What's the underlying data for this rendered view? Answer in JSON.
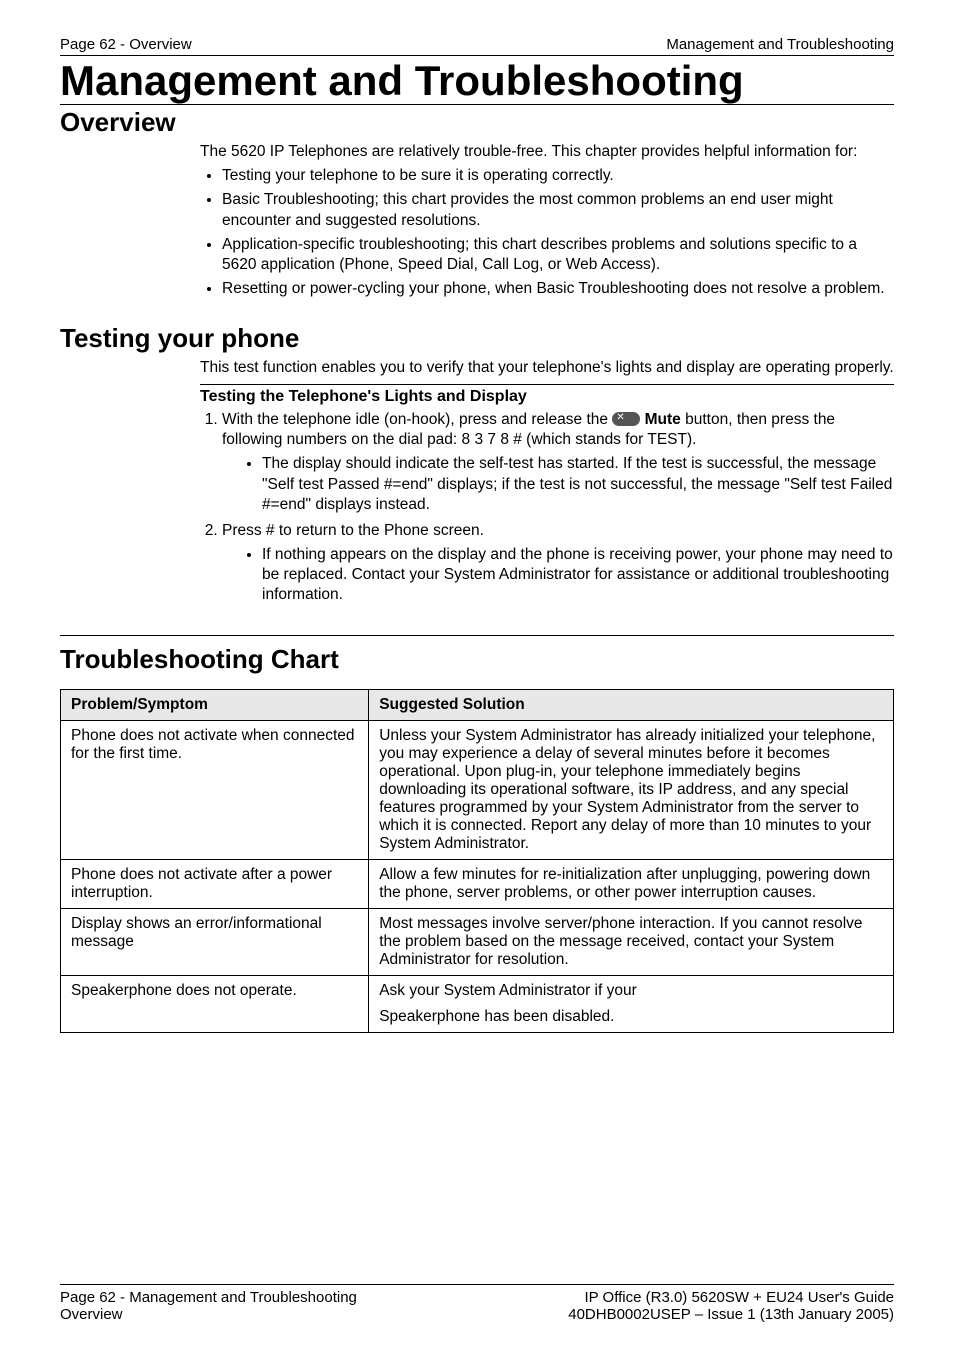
{
  "header": {
    "left": "Page 62 - Overview",
    "right": "Management and Troubleshooting"
  },
  "title": "Management and Troubleshooting",
  "overview": {
    "heading": "Overview",
    "intro": "The 5620 IP Telephones are relatively trouble-free. This chapter provides helpful information for:",
    "bullets": [
      "Testing your telephone to be sure it is operating correctly.",
      "Basic Troubleshooting; this chart provides the most common problems an end user might encounter and suggested resolutions.",
      "Application-specific troubleshooting; this chart describes problems and solutions specific to a 5620 application (Phone, Speed Dial, Call Log, or Web Access).",
      "Resetting or power-cycling your phone, when Basic Troubleshooting does not resolve a problem."
    ]
  },
  "testing": {
    "heading": "Testing your phone",
    "intro": "This test function enables you to verify that your telephone's lights and display are operating properly.",
    "subheading": "Testing the Telephone's Lights and Display",
    "step1_pre": "With the telephone idle (on-hook), press and release the ",
    "mute_label": "Mute",
    "step1_post": " button, then press the following numbers on the dial pad: 8 3 7 8 # (which stands for TEST).",
    "step1_sub": "The display should indicate the self-test has started. If the test is successful, the message \"Self test Passed #=end\" displays; if the test is not successful, the message \"Self test Failed #=end\" displays instead.",
    "step2": "Press # to return to the Phone screen.",
    "step2_sub": "If nothing appears on the display and the phone is receiving power, your phone may need to be replaced. Contact your System Administrator for assistance or additional troubleshooting information."
  },
  "chart": {
    "heading": "Troubleshooting Chart",
    "col1": "Problem/Symptom",
    "col2": "Suggested Solution",
    "rows": [
      {
        "p": "Phone does not activate when connected for the first time.",
        "s": "Unless your System Administrator has already initialized your telephone, you may experience a delay of several minutes before it becomes operational. Upon plug-in, your telephone immediately begins downloading its operational software, its IP address, and any special features programmed by your System Administrator from the server to which it is connected. Report any delay of more than 10 minutes to your System Administrator."
      },
      {
        "p": "Phone does not activate after a power interruption.",
        "s": "Allow a few minutes for re-initialization after unplugging, powering down the phone, server problems, or other power interruption causes."
      },
      {
        "p": "Display shows an error/informational message",
        "s": "Most messages involve server/phone interaction. If you cannot resolve the problem based on the message received, contact your System Administrator for resolution."
      },
      {
        "p": "Speakerphone does not operate.",
        "s1": "Ask your System Administrator if your",
        "s2": "Speakerphone has been disabled."
      }
    ]
  },
  "footer": {
    "l1": "Page 62 - Management and Troubleshooting",
    "r1": "IP Office (R3.0) 5620SW + EU24 User's Guide",
    "l2": "Overview",
    "r2": "40DHB0002USEP – Issue 1 (13th January 2005)"
  }
}
